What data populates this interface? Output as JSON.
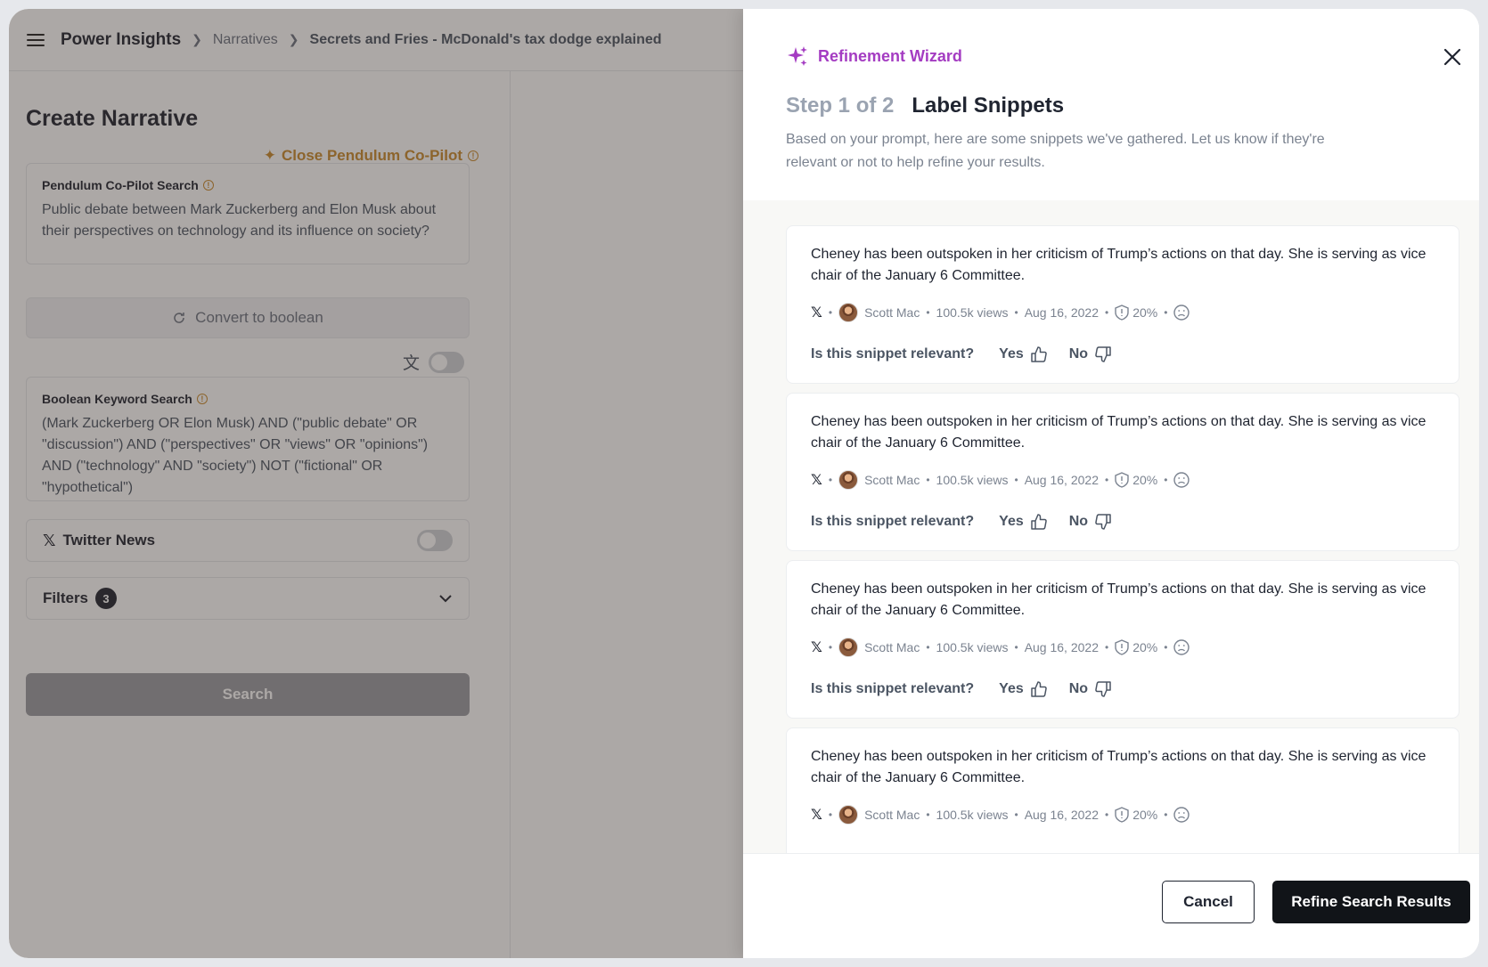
{
  "app": {
    "name": "Power Insights",
    "breadcrumb": [
      "Narratives",
      "Secrets and Fries - McDonald's tax dodge explained"
    ]
  },
  "left": {
    "title": "Create Narrative",
    "copilot_close": "Close Pendulum Co-Pilot",
    "copilot": {
      "label": "Pendulum Co-Pilot Search",
      "text": "Public debate between Mark Zuckerberg and Elon Musk about their perspectives on technology and its influence on society?"
    },
    "convert_label": "Convert to boolean",
    "boolean": {
      "label": "Boolean Keyword Search",
      "text": "(Mark Zuckerberg OR Elon Musk) AND (\"public debate\" OR \"discussion\") AND (\"perspectives\" OR \"views\" OR \"opinions\") AND (\"technology\" AND \"society\") NOT (\"fictional\" OR \"hypothetical\")"
    },
    "twitter_label": "Twitter News",
    "filters_label": "Filters",
    "filters_count": "3",
    "search_label": "Search"
  },
  "wizard": {
    "title": "Refinement Wizard",
    "step": "Step 1 of 2",
    "step_title": "Label Snippets",
    "description": "Based on your prompt, here are some snippets we've gathered. Let us know if they're relevant or not to help refine your results.",
    "question": "Is this snippet relevant?",
    "yes": "Yes",
    "no": "No",
    "snippets": [
      {
        "text": "Cheney has been outspoken in her criticism of Trump’s actions on that day. She is serving as vice chair of the January 6 Committee.",
        "author": "Scott Mac",
        "views": "100.5k views",
        "date": "Aug 16, 2022",
        "score": "20%"
      },
      {
        "text": "Cheney has been outspoken in her criticism of Trump’s actions on that day. She is serving as vice chair of the January 6 Committee.",
        "author": "Scott Mac",
        "views": "100.5k views",
        "date": "Aug 16, 2022",
        "score": "20%"
      },
      {
        "text": "Cheney has been outspoken in her criticism of Trump’s actions on that day. She is serving as vice chair of the January 6 Committee.",
        "author": "Scott Mac",
        "views": "100.5k views",
        "date": "Aug 16, 2022",
        "score": "20%"
      },
      {
        "text": "Cheney has been outspoken in her criticism of Trump’s actions on that day. She is serving as vice chair of the January 6 Committee.",
        "author": "Scott Mac",
        "views": "100.5k views",
        "date": "Aug 16, 2022",
        "score": "20%"
      }
    ],
    "cancel": "Cancel",
    "refine": "Refine Search Results"
  },
  "colors": {
    "accent": "#a43cc2",
    "copilot": "#c98a2d",
    "primary_button": "#111418"
  }
}
